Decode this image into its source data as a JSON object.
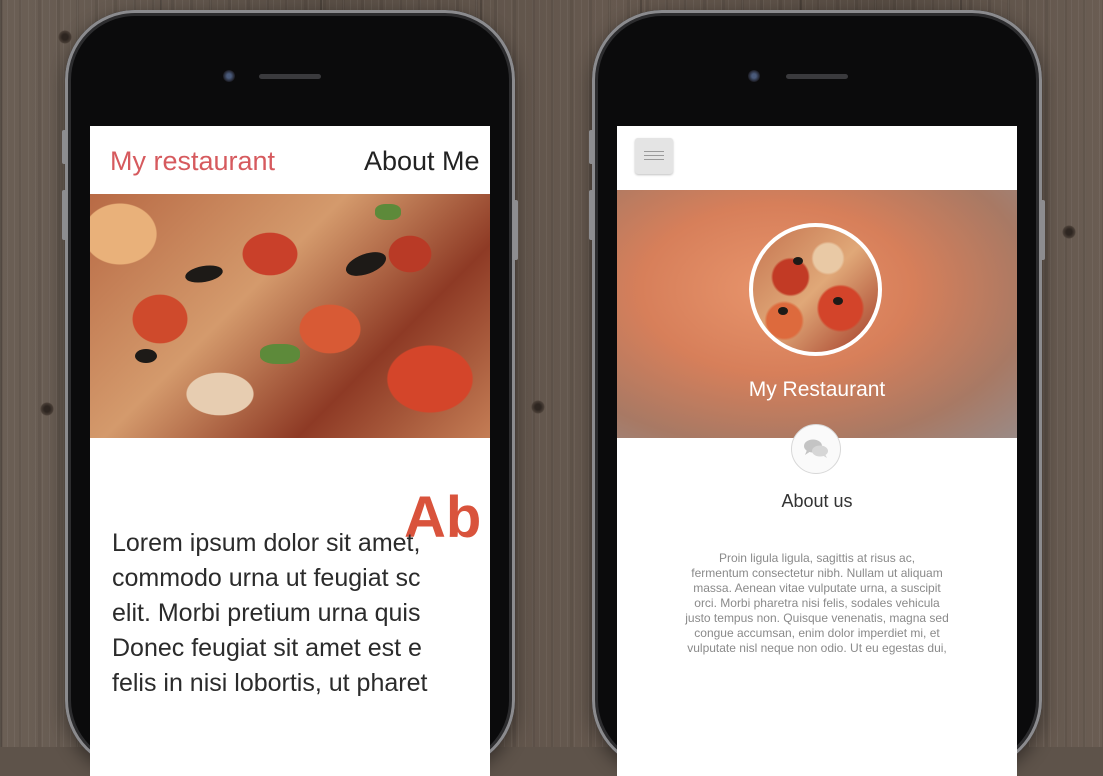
{
  "left_phone": {
    "nav": {
      "brand": "My restaurant",
      "link": "About Me"
    },
    "heading": "Ab",
    "paragraph_lines": [
      "Lorem ipsum dolor sit amet,",
      "commodo urna ut feugiat sc",
      "elit. Morbi pretium urna quis",
      "Donec feugiat sit amet est e",
      "felis in nisi lobortis, ut pharet"
    ],
    "accent_color": "#d65a5e"
  },
  "right_phone": {
    "hero": {
      "title": "My Restaurant"
    },
    "about": {
      "title": "About us",
      "icon": "chat-bubbles-icon",
      "text_lines": [
        "Proin ligula ligula, sagittis at risus ac,",
        "fermentum consectetur nibh. Nullam ut aliquam",
        "massa. Aenean vitae vulputate urna, a suscipit",
        "orci. Morbi pharetra nisi felis, sodales vehicula",
        "justo tempus non. Quisque venenatis, magna sed",
        "congue accumsan, enim dolor imperdiet mi, et",
        "vulputate nisl neque non odio. Ut eu egestas dui,"
      ]
    },
    "menu_icon": "hamburger-menu-icon"
  }
}
